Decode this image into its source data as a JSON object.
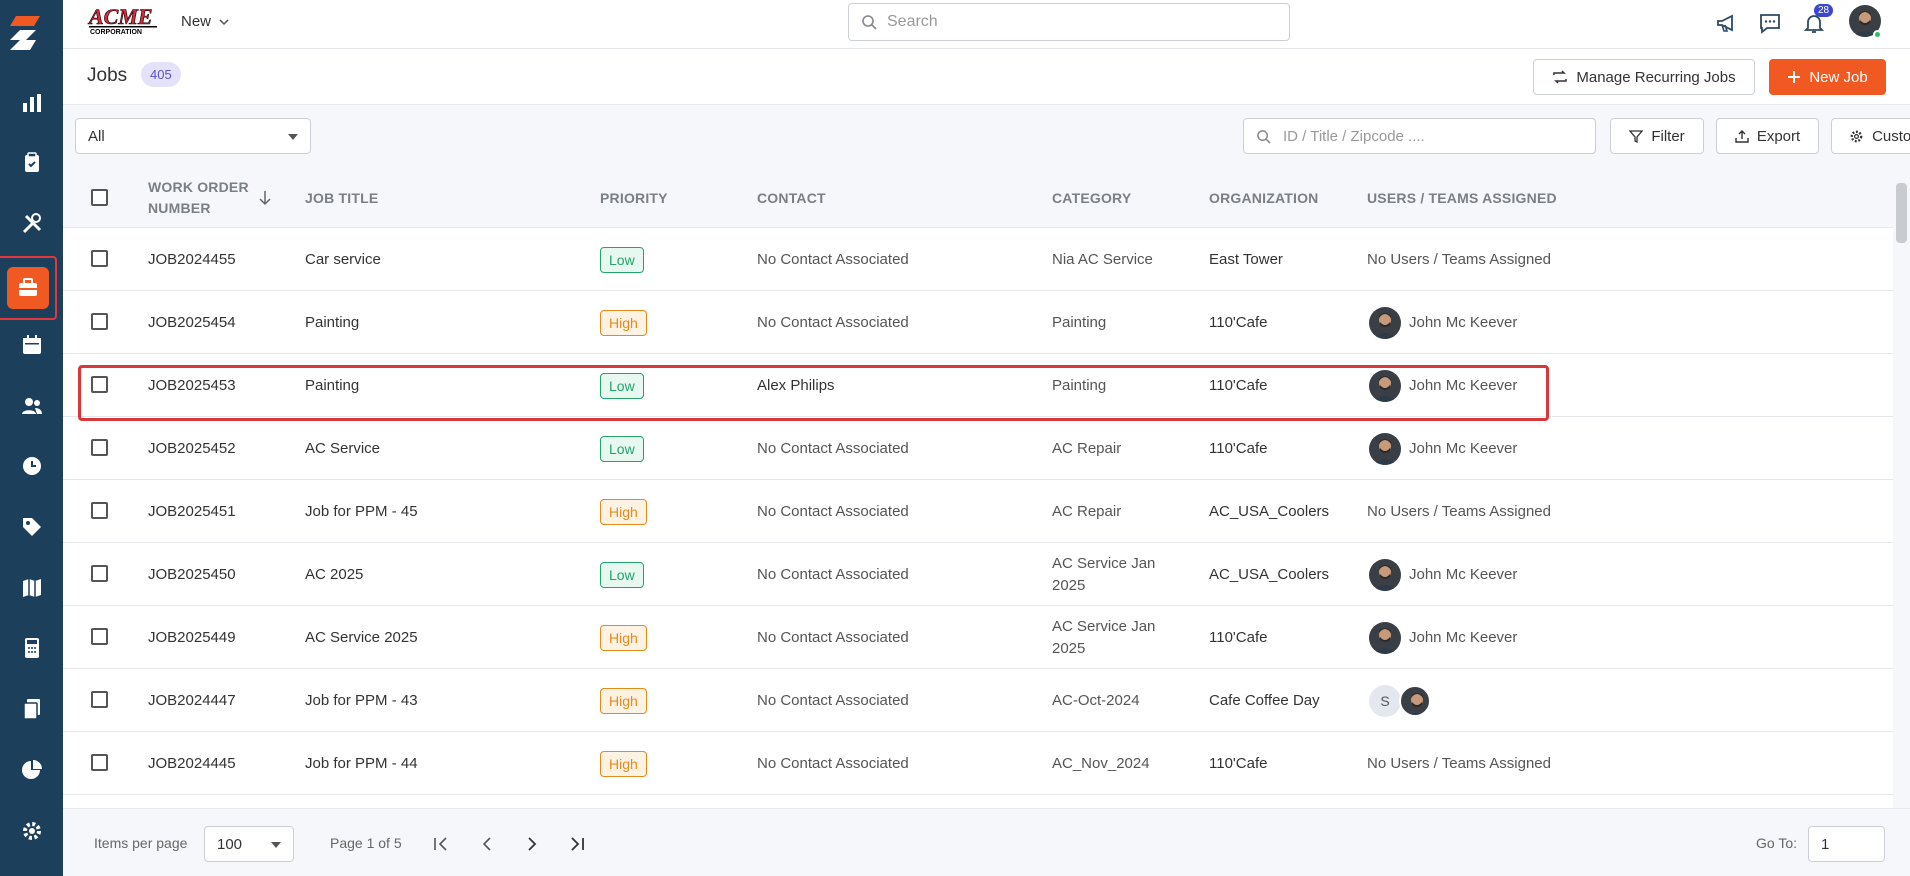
{
  "brand": {
    "name": "ACME",
    "tagline": "CORPORATION"
  },
  "topbar": {
    "new_label": "New",
    "search_placeholder": "Search",
    "notifications_count": "28"
  },
  "page": {
    "title": "Jobs",
    "count": "405",
    "manage_recurring_label": "Manage Recurring Jobs",
    "new_job_label": "New Job"
  },
  "filters": {
    "view_selected": "All",
    "search_placeholder": "ID / Title / Zipcode ....",
    "filter_label": "Filter",
    "export_label": "Export",
    "customize_label": "Customize"
  },
  "table": {
    "columns": {
      "work_order_1": "WORK ORDER",
      "work_order_2": "NUMBER",
      "job_title": "JOB TITLE",
      "priority": "PRIORITY",
      "contact": "CONTACT",
      "category": "CATEGORY",
      "organization": "ORGANIZATION",
      "assigned": "USERS / TEAMS ASSIGNED"
    },
    "rows": [
      {
        "id": "JOB2024455",
        "title": "Car service",
        "priority": "Low",
        "contact": "No Contact Associated",
        "category": "Nia AC Service",
        "org": "East Tower",
        "assigned": "No Users / Teams Assigned"
      },
      {
        "id": "JOB2025454",
        "title": "Painting",
        "priority": "High",
        "contact": "No Contact Associated",
        "category": "Painting",
        "org": "110'Cafe",
        "assigned": "John Mc Keever"
      },
      {
        "id": "JOB2025453",
        "title": "Painting",
        "priority": "Low",
        "contact": "Alex Philips",
        "category": "Painting",
        "org": "110'Cafe",
        "assigned": "John Mc Keever"
      },
      {
        "id": "JOB2025452",
        "title": "AC Service",
        "priority": "Low",
        "contact": "No Contact Associated",
        "category": "AC Repair",
        "org": "110'Cafe",
        "assigned": "John Mc Keever"
      },
      {
        "id": "JOB2025451",
        "title": "Job for PPM - 45",
        "priority": "High",
        "contact": "No Contact Associated",
        "category": "AC Repair",
        "org": "AC_USA_Coolers",
        "assigned": "No Users / Teams Assigned"
      },
      {
        "id": "JOB2025450",
        "title": "AC 2025",
        "priority": "Low",
        "contact": "No Contact Associated",
        "category_1": "AC Service Jan",
        "category_2": "2025",
        "org": "AC_USA_Coolers",
        "assigned": "John Mc Keever"
      },
      {
        "id": "JOB2025449",
        "title": "AC Service 2025",
        "priority": "High",
        "contact": "No Contact Associated",
        "category_1": "AC Service Jan",
        "category_2": "2025",
        "org": "110'Cafe",
        "assigned": "John Mc Keever"
      },
      {
        "id": "JOB2024447",
        "title": "Job for PPM - 43",
        "priority": "High",
        "contact": "No Contact Associated",
        "category": "AC-Oct-2024",
        "org": "Cafe Coffee Day",
        "assigned_initial": "S"
      },
      {
        "id": "JOB2024445",
        "title": "Job for PPM - 44",
        "priority": "High",
        "contact": "No Contact Associated",
        "category": "AC_Nov_2024",
        "org": "110'Cafe",
        "assigned": "No Users / Teams Assigned"
      }
    ]
  },
  "footer": {
    "items_per_page_label": "Items per page",
    "items_per_page_value": "100",
    "page_info": "Page 1 of 5",
    "goto_label": "Go To:",
    "goto_value": "1"
  },
  "colors": {
    "sidebar": "#1c3f5b",
    "accent": "#f05a22",
    "highlight": "#d9383a"
  }
}
